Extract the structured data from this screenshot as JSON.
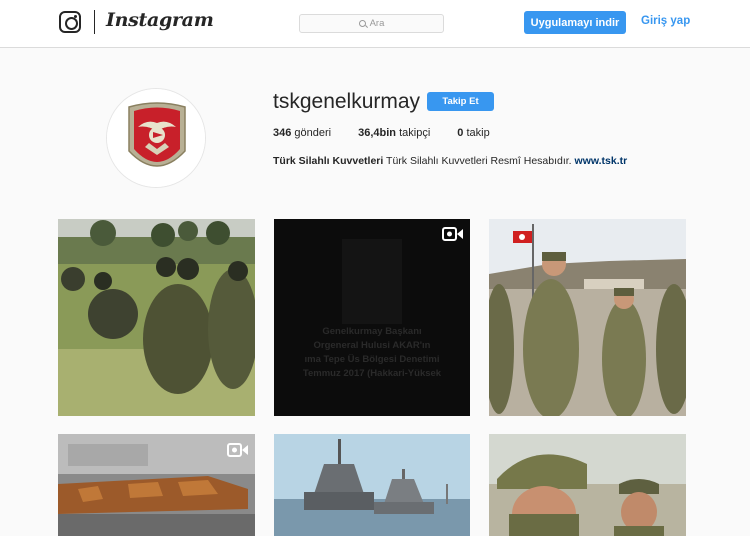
{
  "header": {
    "logo_text": "Instagram",
    "search_placeholder": "Ara",
    "download_button": "Uygulamayı indir",
    "login_link": "Giriş yap"
  },
  "profile": {
    "username": "tskgenelkurmay",
    "follow_button": "Takip Et",
    "stats": [
      {
        "count": "346",
        "label": "gönderi"
      },
      {
        "count": "36,4bin",
        "label": "takipçi"
      },
      {
        "count": "0",
        "label": "takip"
      }
    ],
    "full_name": "Türk Silahlı Kuvvetleri",
    "bio": "Türk Silahlı Kuvvetleri Resmî Hesabıdır.",
    "website": "www.tsk.tr"
  },
  "posts": [
    {
      "type": "photo",
      "description": "soldiers kneeling in field"
    },
    {
      "type": "video",
      "overlay_lines": [
        "Genelkurmay Başkanı",
        "Orgeneral Hulusi AKAR'ın",
        "ıma Tepe Üs Bölgesi Denetimi",
        "Temmuz 2017 (Hakkari-Yüksek"
      ]
    },
    {
      "type": "photo",
      "description": "officers walking with flag"
    },
    {
      "type": "video",
      "description": "helicopter"
    },
    {
      "type": "photo",
      "description": "navy ships"
    },
    {
      "type": "photo",
      "description": "soldiers with helmets"
    }
  ],
  "colors": {
    "accent": "#3897f0",
    "link": "#003569"
  }
}
